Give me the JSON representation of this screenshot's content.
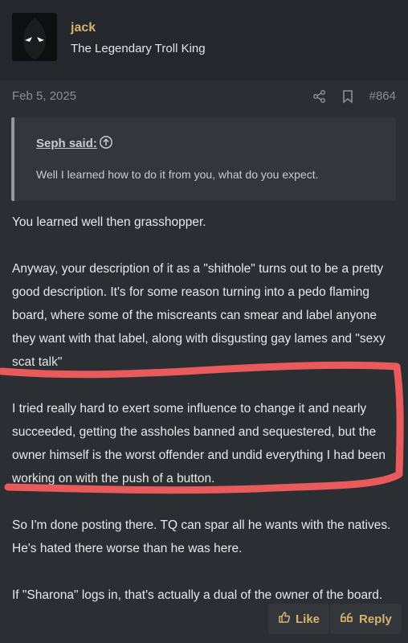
{
  "user": {
    "name": "jack",
    "title": "The Legendary Troll King"
  },
  "post": {
    "date": "Feb 5, 2025",
    "number": "#864",
    "quote": {
      "author": "Seph said:",
      "text": "Well I learned how to do it from you, what do you expect."
    },
    "paragraphs": [
      "You learned well then grasshopper.",
      "Anyway, your description of it as a \"shithole\" turns out to be a pretty good description. It's for some reason turning into a pedo flaming board, where some of the miscreants can smear and label anyone they want with that label, along with disgusting gay lames and \"sexy scat talk\"",
      "I tried really hard to exert some influence to change it and nearly succeeded, getting the assholes banned and sequestered, but the owner himself is the worst offender and undid everything I had been working on with the push of a button.",
      "So I'm done posting there. TQ can spar all he wants with the natives. He's hated there worse than he was here.",
      "If \"Sharona\" logs in, that's actually a dual of the owner of the board."
    ],
    "highlight_color": "#e85a5c"
  },
  "actions": {
    "like_label": "Like",
    "reply_label": "Reply"
  },
  "icons": [
    "share-icon",
    "bookmark-icon",
    "go-to-quote-icon",
    "thumbs-up-icon",
    "quote-icon"
  ]
}
